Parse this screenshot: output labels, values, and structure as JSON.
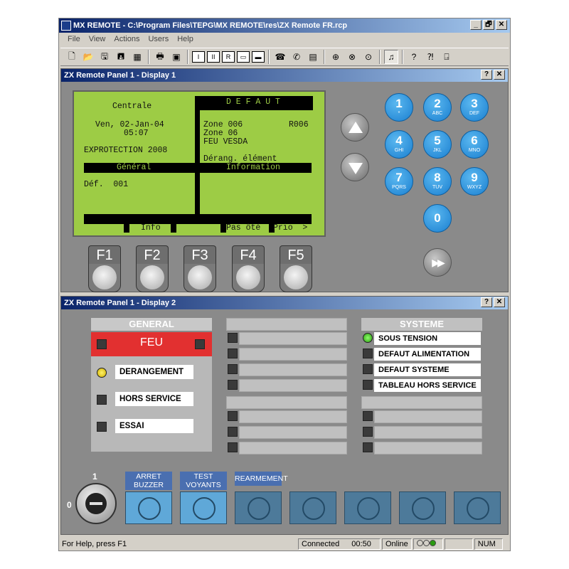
{
  "app": {
    "title": "MX REMOTE - C:\\Program Files\\TEPG\\MX REMOTE\\res\\ZX Remote FR.rcp",
    "window_buttons": {
      "minimize": "_",
      "restore": "🗗",
      "close": "✕"
    }
  },
  "menu": [
    "File",
    "View",
    "Actions",
    "Users",
    "Help"
  ],
  "toolbar": {
    "boxed_labels": [
      "I",
      "II",
      "R"
    ]
  },
  "display1": {
    "title": "ZX Remote Panel 1 - Display 1",
    "help_btn": "?",
    "close_btn": "✕",
    "lcd": {
      "left_title": "Centrale",
      "date_line": "Ven, 02-Jan-04",
      "time_line": "05:07",
      "org": "EXPROTECTION 2008",
      "general_bar": "Général",
      "def_count": "Déf.  001",
      "right_header": "D E F A U T",
      "zone1": "Zone 006",
      "zone1_code": "R006",
      "zone2": "Zone 06",
      "zone3": "FEU VESDA",
      "derang": "Dérang. élément",
      "info_bar": "Information",
      "soft_info": "Info",
      "soft_pas": "Pas ôté",
      "soft_prio": "Prio  >"
    },
    "fkeys": [
      "F1",
      "F2",
      "F3",
      "F4",
      "F5"
    ],
    "numpad": [
      {
        "d": "1",
        "s": "*"
      },
      {
        "d": "2",
        "s": "ABC"
      },
      {
        "d": "3",
        "s": "DEF"
      },
      {
        "d": "4",
        "s": "GHI"
      },
      {
        "d": "5",
        "s": "JKL"
      },
      {
        "d": "6",
        "s": "MNO"
      },
      {
        "d": "7",
        "s": "PQRS"
      },
      {
        "d": "8",
        "s": "TUV"
      },
      {
        "d": "9",
        "s": "WXYZ"
      },
      {
        "d": "0",
        "s": ""
      }
    ],
    "fast_forward": "▶▶"
  },
  "display2": {
    "title": "ZX Remote Panel 1 - Display 2",
    "help_btn": "?",
    "close_btn": "✕",
    "general": {
      "header": "GENERAL",
      "feu": "FEU",
      "items": [
        {
          "label": "DERANGEMENT",
          "led": "yellow"
        },
        {
          "label": "HORS SERVICE",
          "led": "off"
        },
        {
          "label": "ESSAI",
          "led": "off"
        }
      ]
    },
    "systeme": {
      "header": "SYSTEME",
      "items": [
        {
          "label": "SOUS TENSION",
          "led": "green"
        },
        {
          "label": "DEFAUT ALIMENTATION",
          "led": "off"
        },
        {
          "label": "DEFAUT SYSTEME",
          "led": "off"
        },
        {
          "label": "TABLEAU HORS SERVICE",
          "led": "off"
        }
      ]
    },
    "key_switch": {
      "pos1": "1",
      "pos0": "0"
    },
    "buttons": [
      {
        "label1": "ARRET",
        "label2": "BUZZER"
      },
      {
        "label1": "TEST",
        "label2": "VOYANTS"
      },
      {
        "label1": "REARMEMENT",
        "label2": ""
      }
    ]
  },
  "statusbar": {
    "help": "For Help, press F1",
    "connected": "Connected",
    "time": "00:50",
    "online": "Online",
    "num": "NUM"
  }
}
